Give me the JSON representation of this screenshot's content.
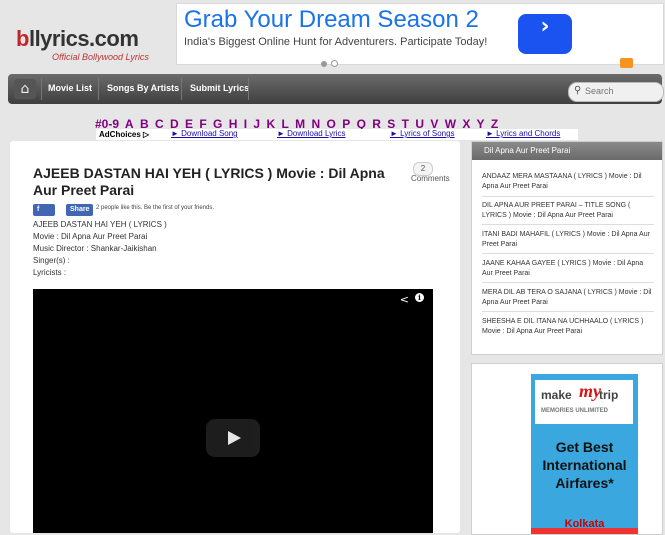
{
  "header": {
    "logo_text_a": "b",
    "logo_text_b": "llyrics.com",
    "tagline": "Official Bollywood Lyrics"
  },
  "top_ad": {
    "headline": "Grab Your Dream Season 2",
    "subline": "India's Biggest Online Hunt for Adventurers. Participate Today!",
    "arrow": "›"
  },
  "nav": {
    "home_icon": "home-icon",
    "items": [
      "Movie List",
      "Songs By Artists",
      "Submit Lyrics"
    ],
    "search_placeholder": "Search"
  },
  "alphabet": [
    "#0-9",
    "A",
    "B",
    "C",
    "D",
    "E",
    "F",
    "G",
    "H",
    "I",
    "J",
    "K",
    "L",
    "M",
    "N",
    "O",
    "P",
    "Q",
    "R",
    "S",
    "T",
    "U",
    "V",
    "W",
    "X",
    "Y",
    "Z"
  ],
  "ad_links": {
    "adchoices": "AdChoices ▷",
    "links": [
      "► Download Song",
      "► Download Lyrics",
      "► Lyrics of Songs",
      "► Lyrics and Chords"
    ]
  },
  "post": {
    "title": "AJEEB DASTAN HAI YEH ( LYRICS ) Movie : Dil Apna Aur Preet Parai",
    "comment_count": "2",
    "comment_label": "Comments",
    "fb_like": "Like",
    "fb_share": "Share",
    "fb_text": "2 people like this. Be the first of your friends.",
    "meta": [
      "AJEEB DASTAN HAI YEH ( LYRICS )",
      "Movie : Dil Apna Aur Preet Parai",
      "Music Director : Shankar-Jaikishan",
      "Singer(s) :",
      "Lyricists :"
    ]
  },
  "sidebar": {
    "heading": "Dil Apna Aur Preet Parai",
    "items": [
      "ANDAAZ MERA MASTAANA ( LYRICS ) Movie : Dil Apna Aur Preet Parai",
      "DIL APNA AUR PREET PARAI – TITLE SONG ( LYRICS ) Movie : Dil Apna Aur Preet Parai",
      "ITANI BADI MAHAFIL ( LYRICS ) Movie : Dil Apna Aur Preet Parai",
      "JAANE KAHAA GAYEE ( LYRICS ) Movie : Dil Apna Aur Preet Parai",
      "MERA DIL AB TERA O SAJANA ( LYRICS ) Movie : Dil Apna Aur Preet Parai",
      "SHEESHA E DIL ITANA NA UCHHAALO ( LYRICS ) Movie : Dil Apna Aur Preet Parai"
    ]
  },
  "side_ad": {
    "brand_a": "make",
    "brand_b": "my",
    "brand_c": "trip",
    "sub": "MEMORIES UNLIMITED",
    "text": "Get Best International Airfares*",
    "city": "Kolkata",
    "adchoices": "▷"
  }
}
